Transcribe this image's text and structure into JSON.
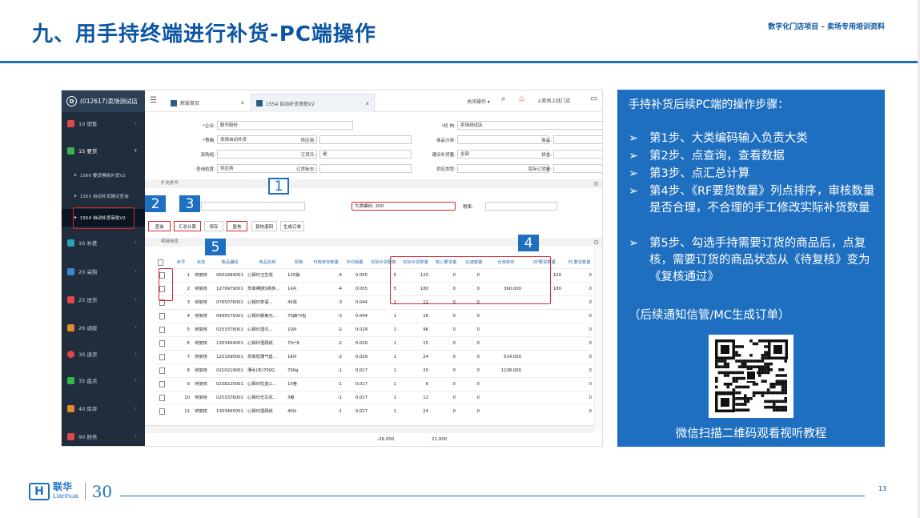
{
  "slide": {
    "title": "九、用手持终端进行补货-PC端操作",
    "subtitle": "数字化门店项目 – 卖场专用培训资料",
    "page_number": "13",
    "brand": {
      "name_cn": "联华",
      "name_en": "Lianhua",
      "anniv": "30"
    }
  },
  "app": {
    "store": "(012617)卖场测试店",
    "sidebar": [
      {
        "label": "10 销售"
      },
      {
        "label": "15 要货"
      },
      {
        "label": "16 补差"
      },
      {
        "label": "20 采购"
      },
      {
        "label": "25 进货"
      },
      {
        "label": "26 调拨"
      },
      {
        "label": "30 退货"
      },
      {
        "label": "35 盘点"
      },
      {
        "label": "40 库存"
      },
      {
        "label": "90 财务"
      }
    ],
    "submenu": [
      {
        "label": "1566 要货模板补货V2"
      },
      {
        "label": "1555 自动补货建议查询"
      },
      {
        "label": "1554 自动补货审批V2"
      }
    ],
    "tabs": [
      "新版首页",
      "1554 自动补货审批V2"
    ],
    "tab_close": "x",
    "topbar": {
      "close_ops": "关闭操作",
      "user": "卖场上线门店"
    },
    "form": {
      "enterprise_label": "*企业:",
      "enterprise_value": "联华股份",
      "org_label": "*机 构:",
      "org_value": "卖场测试店",
      "strategy_label": "*策略:",
      "strategy_value": "卖场自动补货",
      "supplier_label": "供应商:",
      "goods_cat_label": "商品分类:",
      "goods_label": "商品:",
      "group_label": "采购组:",
      "order_day_label": "订货日:",
      "order_day_value": "是",
      "suggest_label": "建议补货量:",
      "suggest_value": "全部",
      "status_label": "状态:",
      "dim_label": "查询粒度:",
      "dim_value": "供应商",
      "order_flag_label": "订货标志:",
      "supply_type_label": "供应类型:",
      "actual_qty_label": "实际订货量:",
      "ext_label": "扩充条件",
      "category_label": "大类编码:",
      "category_value": "200",
      "tax_label": "税率:"
    },
    "buttons": [
      "查询",
      "汇总计算",
      "保存",
      "复核",
      "复核退回",
      "生成订单"
    ],
    "detail_label": "明细信息",
    "columns": [
      "序号",
      "状态",
      "商品编码",
      "商品名称",
      "规格",
      "可用库存数量",
      "平均销量",
      "实际补货额数",
      "实际补货数量",
      "核心要求量",
      "在途数量",
      "仓库库存",
      "RF要货数量",
      "PC要货数量"
    ],
    "rows": [
      {
        "no": "1",
        "status": "待复核",
        "code": "0601894001",
        "name": "心相印卫生纸",
        "spec": "120抽",
        "stock": "-4",
        "avg": "0.055",
        "amt": "5",
        "qty": "120",
        "core": "0",
        "transit": "0",
        "wh": "",
        "rf": "120",
        "pc": "0"
      },
      {
        "no": "2",
        "status": "待复核",
        "code": "1279979001",
        "name": "苏菲裸感S贵族...",
        "spec": "14片",
        "stock": "-4",
        "avg": "0.055",
        "amt": "5",
        "qty": "180",
        "core": "0",
        "transit": "0",
        "wh": "360.000",
        "rf": "180",
        "pc": "0"
      },
      {
        "no": "3",
        "status": "待复核",
        "code": "0765076001",
        "name": "心相印茶语...",
        "spec": "40张",
        "stock": "-3",
        "avg": "0.044",
        "amt": "1",
        "qty": "12",
        "core": "0",
        "transit": "0",
        "wh": "",
        "rf": "",
        "pc": "0"
      },
      {
        "no": "4",
        "status": "待复核",
        "code": "0495575001",
        "name": "心相印婴美元...",
        "spec": "70抽*3包",
        "stock": "-3",
        "avg": "0.044",
        "amt": "1",
        "qty": "16",
        "core": "0",
        "transit": "0",
        "wh": "",
        "rf": "",
        "pc": "0"
      },
      {
        "no": "5",
        "status": "待复核",
        "code": "0253378001",
        "name": "心相印湿巾...",
        "spec": "10片",
        "stock": "-2",
        "avg": "0.029",
        "amt": "1",
        "qty": "96",
        "core": "0",
        "transit": "0",
        "wh": "",
        "rf": "",
        "pc": "0"
      },
      {
        "no": "6",
        "status": "待复核",
        "code": "1303464001",
        "name": "心相印湿厕纸",
        "spec": "7片*8",
        "stock": "-2",
        "avg": "0.029",
        "amt": "1",
        "qty": "15",
        "core": "0",
        "transit": "0",
        "wh": "",
        "rf": "",
        "pc": "0"
      },
      {
        "no": "7",
        "status": "待复核",
        "code": "1251690001",
        "name": "苏菲轻薄气垫...",
        "spec": "16片",
        "stock": "-2",
        "avg": "0.029",
        "amt": "1",
        "qty": "24",
        "core": "0",
        "transit": "0",
        "wh": "514.000",
        "rf": "",
        "pc": "0"
      },
      {
        "no": "8",
        "status": "待复核",
        "code": "0210219001",
        "name": "漂水(衣)700G",
        "spec": "700g",
        "stock": "-1",
        "avg": "0.017",
        "amt": "1",
        "qty": "20",
        "core": "0",
        "transit": "0",
        "wh": "1108.000",
        "rf": "",
        "pc": "0"
      },
      {
        "no": "9",
        "status": "待复核",
        "code": "0238220001",
        "name": "心相印优选三...",
        "spec": "10卷",
        "stock": "-1",
        "avg": "0.017",
        "amt": "1",
        "qty": "6",
        "core": "0",
        "transit": "0",
        "wh": "",
        "rf": "",
        "pc": "0"
      },
      {
        "no": "10",
        "status": "待复核",
        "code": "0253376001",
        "name": "心相印无芯花...",
        "spec": "3卷",
        "stock": "-1",
        "avg": "0.017",
        "amt": "1",
        "qty": "12",
        "core": "0",
        "transit": "0",
        "wh": "",
        "rf": "",
        "pc": "0"
      },
      {
        "no": "11",
        "status": "待复核",
        "code": "1303465001",
        "name": "心相印湿厕纸",
        "spec": "40片",
        "stock": "-1",
        "avg": "0.017",
        "amt": "1",
        "qty": "24",
        "core": "0",
        "transit": "0",
        "wh": "",
        "rf": "",
        "pc": "0"
      }
    ],
    "totals": {
      "stock": "-26.000",
      "amt": "21.000"
    }
  },
  "callouts": [
    "1",
    "2",
    "3",
    "4",
    "5"
  ],
  "panel": {
    "title": "手持补货后续PC端的操作步骤：",
    "bullet": "➢",
    "steps": [
      "第1步、大类编码输入负责大类",
      "第2步、点查询，查看数据",
      "第3步、点汇总计算",
      "第4步、《RF要货数量》列点排序，审核数量是否合理，不合理的手工修改实际补货数量",
      "第5步、勾选手持需要订货的商品后，点复核，需要订货的商品状态从《待复核》变为《复核通过》"
    ],
    "note": "（后续通知信管/MC生成订单）",
    "qr_caption": "微信扫描二维码观看视听教程"
  },
  "colors": {
    "brand_blue": "#1f6fc0",
    "title_blue": "#0c55a3",
    "highlight_red": "#d9262b",
    "sidebar_dark": "#1f2d3d"
  }
}
